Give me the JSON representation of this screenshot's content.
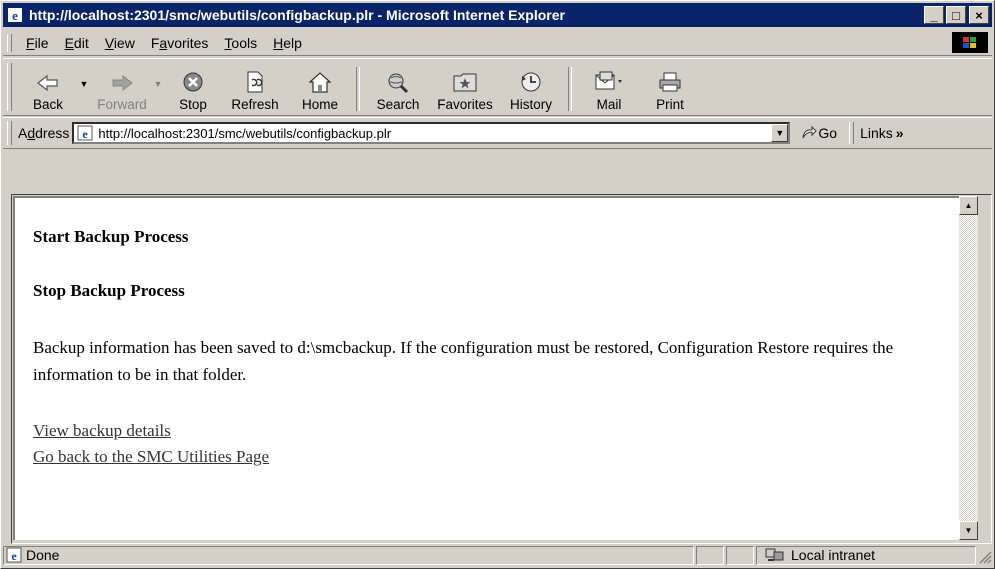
{
  "window": {
    "title": "http://localhost:2301/smc/webutils/configbackup.plr - Microsoft Internet Explorer",
    "controls": {
      "minimize": "_",
      "maximize": "□",
      "close": "×"
    }
  },
  "menu": [
    {
      "label": "File",
      "mnemonic": "F",
      "rest": "ile"
    },
    {
      "label": "Edit",
      "mnemonic": "E",
      "rest": "dit"
    },
    {
      "label": "View",
      "mnemonic": "V",
      "rest": "iew"
    },
    {
      "label": "Favorites",
      "pre": "F",
      "mnemonic": "a",
      "rest": "vorites"
    },
    {
      "label": "Tools",
      "mnemonic": "T",
      "rest": "ools"
    },
    {
      "label": "Help",
      "mnemonic": "H",
      "rest": "elp"
    }
  ],
  "toolbar": {
    "back": "Back",
    "forward": "Forward",
    "stop": "Stop",
    "refresh": "Refresh",
    "home": "Home",
    "search": "Search",
    "favorites": "Favorites",
    "history": "History",
    "mail": "Mail",
    "print": "Print"
  },
  "address": {
    "label_pre": "A",
    "label_mn": "d",
    "label_rest": "dress",
    "url": "http://localhost:2301/smc/webutils/configbackup.plr",
    "go": "Go",
    "links": "Links",
    "links_chevron": "»"
  },
  "page": {
    "heading1": "Start Backup Process",
    "heading2": "Stop Backup Process",
    "message": "Backup information has been saved to d:\\smcbackup. If the configuration must be restored, Configuration Restore requires the information to be in that folder.",
    "link1": "View backup details",
    "link2": "Go back to the SMC Utilities Page"
  },
  "status": {
    "text": "Done",
    "zone": "Local intranet"
  },
  "colors": {
    "titlebar": "#0a246a",
    "chrome": "#d4d0c8"
  }
}
